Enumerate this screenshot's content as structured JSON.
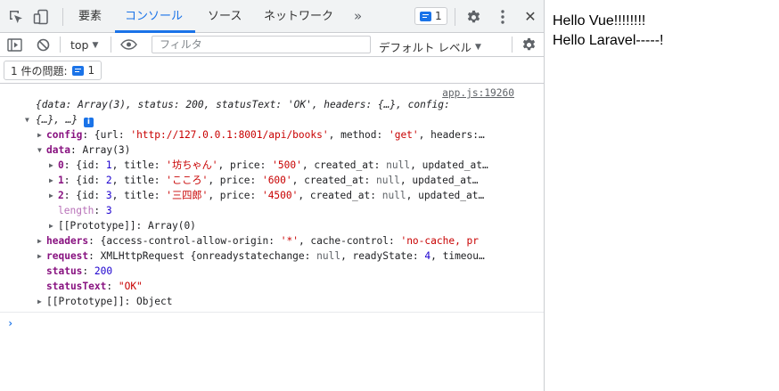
{
  "devtools": {
    "tabs": [
      "要素",
      "コンソール",
      "ソース",
      "ネットワーク"
    ],
    "more_tabs": "»",
    "issues_badge_count": "1",
    "close": "✕",
    "toolbar": {
      "context": "top",
      "filter_placeholder": "フィルタ",
      "levels": "デフォルト レベル"
    },
    "issues_bar": {
      "label": "1 件の問題:",
      "count": "1"
    },
    "console": {
      "source_link": "app.js:19260",
      "summary_line1": "{data: Array(3), status: 200, statusText: 'OK', headers: {…}, config:",
      "summary_line2": "{…}, …}",
      "config_key": "config",
      "config_val_pre": "{url: ",
      "config_url": "'http://127.0.0.1:8001/api/books'",
      "config_val_mid": ", method: ",
      "config_method": "'get'",
      "config_val_post": ", headers:…",
      "data_key": "data",
      "data_val": "Array(3)",
      "items": [
        {
          "idx": "0",
          "id": "1",
          "title": "'坊ちゃん'",
          "price": "'500'"
        },
        {
          "idx": "1",
          "id": "2",
          "title": "'こころ'",
          "price": "'600'"
        },
        {
          "idx": "2",
          "id": "3",
          "title": "'三四郎'",
          "price": "'4500'"
        }
      ],
      "item_created_key": "created_at",
      "item_null": "null",
      "item_updated_tail": "updated_at…",
      "length_key": "length",
      "length_val": "3",
      "data_proto": "[[Prototype]]: Array(0)",
      "headers_key": "headers",
      "headers_val_pre": "{access-control-allow-origin: ",
      "headers_acao": "'*'",
      "headers_val_mid": ", cache-control: ",
      "headers_cc": "'no-cache, pr",
      "request_key": "request",
      "request_val_pre": "XMLHttpRequest {onreadystatechange: ",
      "request_null": "null",
      "request_val_mid": ", readyState: ",
      "request_ready": "4",
      "request_val_post": ", timeou…",
      "status_key": "status",
      "status_val": "200",
      "statustext_key": "statusText",
      "statustext_val": "\"OK\"",
      "obj_proto": "[[Prototype]]: Object",
      "prompt": "›"
    }
  },
  "page": {
    "line1": "Hello Vue!!!!!!!!",
    "line2": "Hello Laravel-----!"
  },
  "colors": {
    "accent": "#1a73e8",
    "string": "#c80000",
    "number": "#1c00cf",
    "key": "#881280"
  }
}
